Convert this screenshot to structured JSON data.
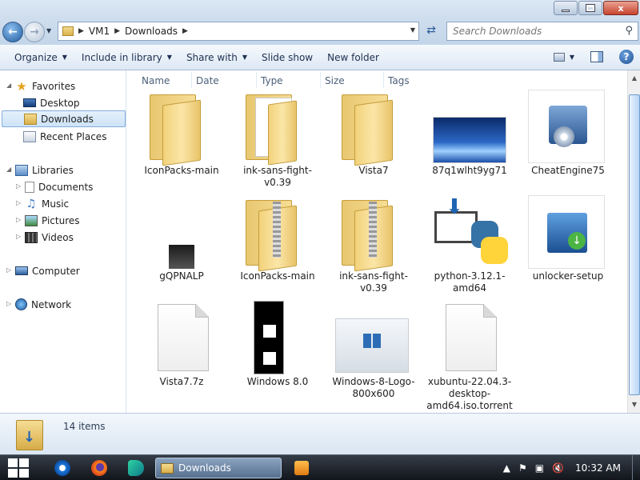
{
  "window": {
    "minimize_icon": "minimize-icon",
    "maximize_icon": "maximize-icon",
    "close_label": "x"
  },
  "address": {
    "crumbs": [
      "VM1",
      "Downloads"
    ],
    "search_placeholder": "Search Downloads"
  },
  "toolbar": {
    "organize": "Organize",
    "include_in_library": "Include in library",
    "share_with": "Share with",
    "slide_show": "Slide show",
    "new_folder": "New folder"
  },
  "navpane": {
    "favorites": "Favorites",
    "desktop": "Desktop",
    "downloads": "Downloads",
    "recent_places": "Recent Places",
    "libraries": "Libraries",
    "documents": "Documents",
    "music": "Music",
    "pictures": "Pictures",
    "videos": "Videos",
    "computer": "Computer",
    "network": "Network"
  },
  "columns": [
    "Name",
    "Date",
    "Type",
    "Size",
    "Tags"
  ],
  "files": [
    {
      "name": "IconPacks-main",
      "icon": "folder-icon"
    },
    {
      "name": "ink-sans-fight-v0.39",
      "icon": "folder-icon"
    },
    {
      "name": "Vista7",
      "icon": "folder-icon"
    },
    {
      "name": "87q1wlht9yg71",
      "icon": "image-icon"
    },
    {
      "name": "CheatEngine75",
      "icon": "installer-icon"
    },
    {
      "name": "gQPNALP",
      "icon": "image-icon"
    },
    {
      "name": "IconPacks-main",
      "icon": "zip-folder-icon"
    },
    {
      "name": "ink-sans-fight-v0.39",
      "icon": "zip-folder-icon"
    },
    {
      "name": "python-3.12.1-amd64",
      "icon": "python-installer-icon"
    },
    {
      "name": "unlocker-setup",
      "icon": "installer-icon"
    },
    {
      "name": "Vista7.7z",
      "icon": "file-icon"
    },
    {
      "name": "Windows 8.0",
      "icon": "image-icon"
    },
    {
      "name": "Windows-8-Logo-800x600",
      "icon": "image-icon"
    },
    {
      "name": "xubuntu-22.04.3-desktop-amd64.iso.torrent",
      "icon": "file-icon"
    }
  ],
  "details": {
    "count": "14 items"
  },
  "taskbar": {
    "active_window": "Downloads",
    "clock": "10:32 AM"
  }
}
